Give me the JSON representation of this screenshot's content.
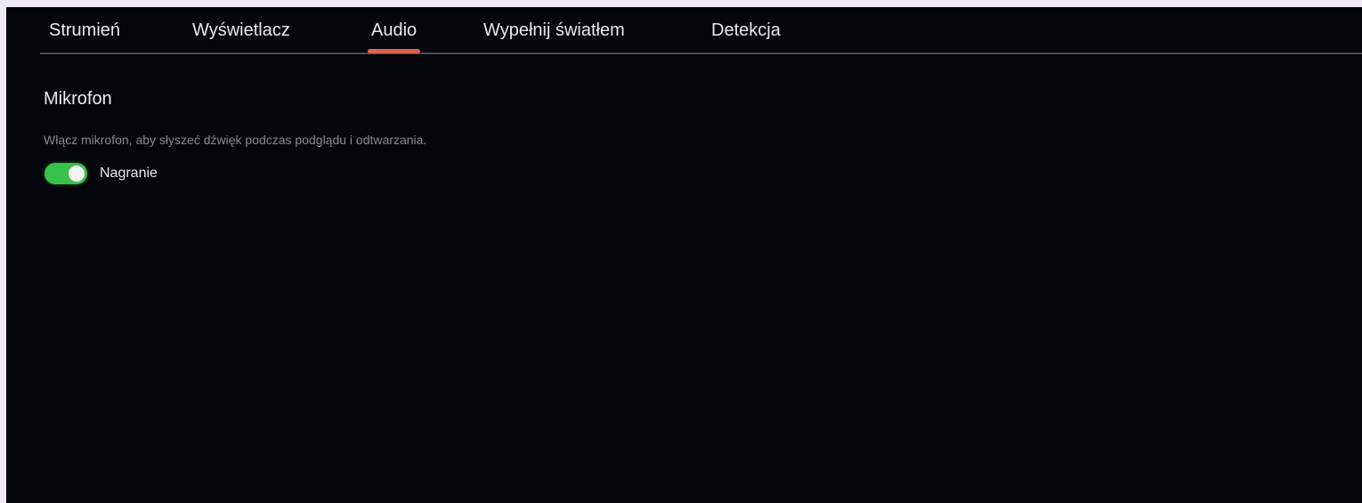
{
  "tabs": [
    {
      "label": "Strumień",
      "active": false
    },
    {
      "label": "Wyświetlacz",
      "active": false
    },
    {
      "label": "Audio",
      "active": true
    },
    {
      "label": "Wypełnij światłem",
      "active": false
    },
    {
      "label": "Detekcja",
      "active": false
    }
  ],
  "microphone": {
    "title": "Mikrofon",
    "description": "Włącz mikrofon, aby słyszeć dźwięk podczas podglądu i odtwarzania.",
    "toggle": {
      "label": "Nagranie",
      "enabled": true,
      "color": "#39c24a"
    }
  },
  "colors": {
    "background": "#04050a",
    "active_tab_indicator": "#e0614f"
  }
}
